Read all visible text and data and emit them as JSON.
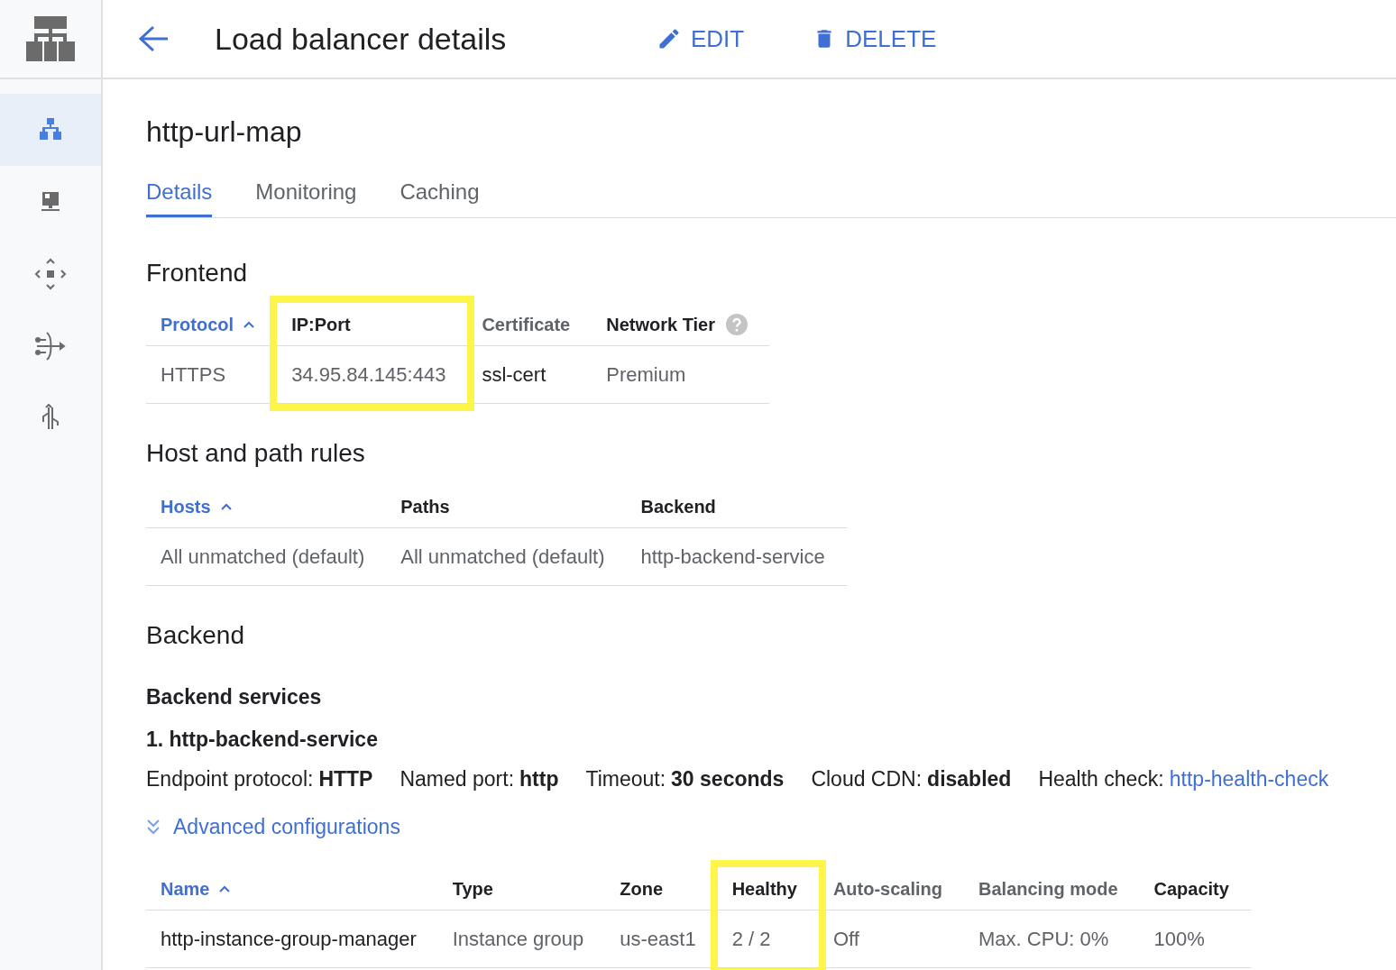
{
  "header": {
    "title": "Load balancer details",
    "actions": [
      {
        "label": "EDIT",
        "kind": "edit"
      },
      {
        "label": "DELETE",
        "kind": "delete"
      }
    ]
  },
  "sidebar": {
    "items": [
      {
        "kind": "lb",
        "selected": true
      },
      {
        "kind": "monitor",
        "selected": false
      },
      {
        "kind": "move",
        "selected": false
      },
      {
        "kind": "merge",
        "selected": false
      },
      {
        "kind": "split",
        "selected": false
      }
    ]
  },
  "name": "http-url-map",
  "tabs": [
    {
      "label": "Details",
      "selected": true
    },
    {
      "label": "Monitoring",
      "selected": false
    },
    {
      "label": "Caching",
      "selected": false
    }
  ],
  "frontend": {
    "heading": "Frontend",
    "table": {
      "columns": [
        {
          "label": "Protocol",
          "kind": "sorted",
          "dark_cells": false
        },
        {
          "label": "IP:Port",
          "kind": "strong",
          "dark_cells": false,
          "highlighted": true
        },
        {
          "label": "Certificate",
          "kind": "muted",
          "dark_cells": true
        },
        {
          "label": "Network Tier",
          "kind": "strong",
          "dark_cells": false,
          "help": true
        }
      ],
      "rows": [
        [
          "HTTPS",
          "34.95.84.145:443",
          "ssl-cert",
          "Premium"
        ]
      ]
    }
  },
  "rules": {
    "heading": "Host and path rules",
    "table": {
      "columns": [
        {
          "label": "Hosts",
          "kind": "sorted",
          "dark_cells": false
        },
        {
          "label": "Paths",
          "kind": "strong",
          "dark_cells": false
        },
        {
          "label": "Backend",
          "kind": "strong",
          "dark_cells": false
        }
      ],
      "rows": [
        [
          "All unmatched (default)",
          "All unmatched (default)",
          "http-backend-service"
        ]
      ]
    }
  },
  "backend": {
    "heading": "Backend",
    "subheading": "Backend services",
    "service": "1. http-backend-service",
    "details": [
      {
        "label": "Endpoint protocol:",
        "value": "HTTP",
        "kind": "bold"
      },
      {
        "label": "Named port:",
        "value": "http",
        "kind": "bold"
      },
      {
        "label": "Timeout:",
        "value": "30 seconds",
        "kind": "bold"
      },
      {
        "label": "Cloud CDN:",
        "value": "disabled",
        "kind": "bold"
      },
      {
        "label": "Health check:",
        "value": "http-health-check",
        "kind": "link"
      }
    ],
    "advanced": {
      "label": "Advanced configurations",
      "expanded": false
    },
    "table": {
      "columns": [
        {
          "label": "Name",
          "kind": "sorted",
          "dark_cells": true
        },
        {
          "label": "Type",
          "kind": "strong",
          "dark_cells": false
        },
        {
          "label": "Zone",
          "kind": "strong",
          "dark_cells": false
        },
        {
          "label": "Healthy",
          "kind": "strong",
          "dark_cells": false,
          "highlighted": true
        },
        {
          "label": "Auto-scaling",
          "kind": "muted",
          "dark_cells": false
        },
        {
          "label": "Balancing mode",
          "kind": "muted",
          "dark_cells": false
        },
        {
          "label": "Capacity",
          "kind": "strong",
          "dark_cells": false
        }
      ],
      "rows": [
        [
          "http-instance-group-manager",
          "Instance group",
          "us-east1",
          "2 / 2",
          "Off",
          "Max. CPU: 0%",
          "100%"
        ]
      ]
    }
  }
}
